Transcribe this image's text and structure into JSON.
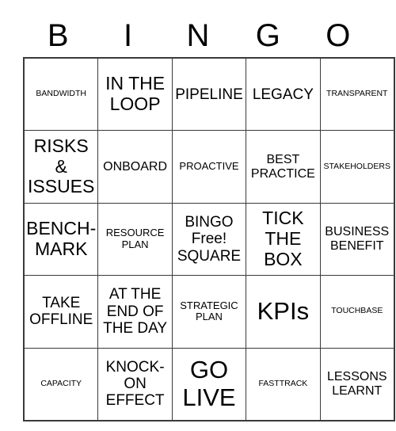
{
  "header": {
    "letters": [
      "B",
      "I",
      "N",
      "G",
      "O"
    ]
  },
  "grid": {
    "columns": 5,
    "rows": 5,
    "border_color": "#3a3a3a",
    "background_color": "#ffffff",
    "text_color": "#000000",
    "cells": [
      {
        "text": "BANDWIDTH",
        "size": "sz-xs",
        "free": false
      },
      {
        "text": "IN THE LOOP",
        "size": "sz-xl",
        "free": false
      },
      {
        "text": "PIPELINE",
        "size": "sz-l",
        "free": false
      },
      {
        "text": "LEGACY",
        "size": "sz-l",
        "free": false
      },
      {
        "text": "TRANSPARENT",
        "size": "sz-xs",
        "free": false
      },
      {
        "text": "RISKS & ISSUES",
        "size": "sz-xl",
        "free": false
      },
      {
        "text": "ONBOARD",
        "size": "sz-m",
        "free": false
      },
      {
        "text": "PROACTIVE",
        "size": "sz-s",
        "free": false
      },
      {
        "text": "BEST PRACTICE",
        "size": "sz-m",
        "free": false
      },
      {
        "text": "STAKEHOLDERS",
        "size": "sz-xs",
        "free": false
      },
      {
        "text": "BENCH- MARK",
        "size": "sz-xl",
        "free": false
      },
      {
        "text": "RESOURCE PLAN",
        "size": "sz-s",
        "free": false
      },
      {
        "text": "BINGO Free! SQUARE",
        "size": "sz-l",
        "free": true
      },
      {
        "text": "TICK THE BOX",
        "size": "sz-xl",
        "free": false
      },
      {
        "text": "BUSINESS BENEFIT",
        "size": "sz-m",
        "free": false
      },
      {
        "text": "TAKE OFFLINE",
        "size": "sz-l",
        "free": false
      },
      {
        "text": "AT THE END OF THE DAY",
        "size": "sz-l",
        "free": false
      },
      {
        "text": "STRATEGIC PLAN",
        "size": "sz-s",
        "free": false
      },
      {
        "text": "KPIs",
        "size": "sz-xxl",
        "free": false
      },
      {
        "text": "TOUCHBASE",
        "size": "sz-xs",
        "free": false
      },
      {
        "text": "CAPACITY",
        "size": "sz-xs",
        "free": false
      },
      {
        "text": "KNOCK- ON EFFECT",
        "size": "sz-l",
        "free": false
      },
      {
        "text": "GO LIVE",
        "size": "sz-xxl",
        "free": false
      },
      {
        "text": "FASTTRACK",
        "size": "sz-xs",
        "free": false
      },
      {
        "text": "LESSONS LEARNT",
        "size": "sz-m",
        "free": false
      }
    ]
  }
}
